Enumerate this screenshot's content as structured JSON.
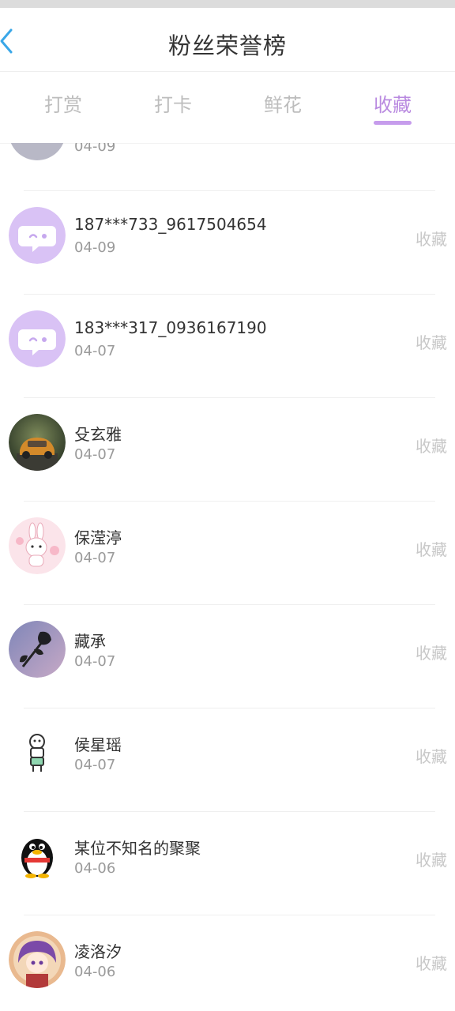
{
  "header": {
    "title": "粉丝荣誉榜"
  },
  "tabs": [
    {
      "label": "打赏",
      "active": false
    },
    {
      "label": "打卡",
      "active": false
    },
    {
      "label": "鲜花",
      "active": false
    },
    {
      "label": "收藏",
      "active": true
    }
  ],
  "colors": {
    "accent": "#c69cec",
    "back_icon": "#3aa7e8"
  },
  "partial_item": {
    "date": "04-09"
  },
  "items": [
    {
      "name": "187***733_9617504654",
      "date": "04-09",
      "action": "收藏",
      "avatar": "chat-bubble-avatar"
    },
    {
      "name": "183***317_0936167190",
      "date": "04-07",
      "action": "收藏",
      "avatar": "chat-bubble-avatar"
    },
    {
      "name": "殳玄雅",
      "date": "04-07",
      "action": "收藏",
      "avatar": "car-photo-avatar"
    },
    {
      "name": "保滢渟",
      "date": "04-07",
      "action": "收藏",
      "avatar": "bunny-avatar"
    },
    {
      "name": "藏承",
      "date": "04-07",
      "action": "收藏",
      "avatar": "rose-photo-avatar"
    },
    {
      "name": "侯星瑶",
      "date": "04-07",
      "action": "收藏",
      "avatar": "cartoon-figure-avatar"
    },
    {
      "name": "某位不知名的聚聚",
      "date": "04-06",
      "action": "收藏",
      "avatar": "penguin-avatar"
    },
    {
      "name": "凌洛汐",
      "date": "04-06",
      "action": "收藏",
      "avatar": "anime-girl-avatar"
    }
  ]
}
